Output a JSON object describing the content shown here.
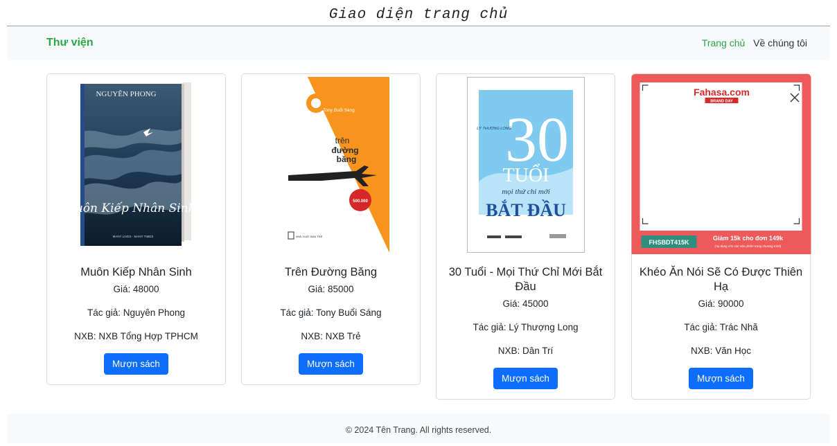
{
  "page_caption": "Giao diện trang chủ",
  "navbar": {
    "brand": "Thư viện",
    "links": [
      "Trang chủ",
      "Về chúng tôi"
    ]
  },
  "books": [
    {
      "title": "Muôn Kiếp Nhân Sinh",
      "price": "Giá: 48000",
      "author": "Tác giả: Nguyên Phong",
      "publisher": "NXB: NXB Tổng Hợp TPHCM",
      "button": "Mượn sách",
      "cover": {
        "author_text": "NGUYÊN PHONG",
        "title_text": "Muôn Kiếp Nhân Sinh",
        "sub": "MANY LIVES - MANY TIMES"
      }
    },
    {
      "title": "Trên Đường Băng",
      "price": "Giá: 85000",
      "author": "Tác giả: Tony Buổi Sáng",
      "publisher": "NXB: NXB Trẻ",
      "button": "Mượn sách",
      "cover": {
        "author_text": "Tony Buổi Sáng",
        "title_line1": "trên",
        "title_line2": "đường",
        "title_line3": "băng",
        "badge": "500.000",
        "publisher_text": "NHÀ XUẤT BẢN TRẺ"
      }
    },
    {
      "title": "30 Tuổi - Mọi Thứ Chỉ Mới Bắt Đầu",
      "price": "Giá: 45000",
      "author": "Tác giả: Lý Thượng Long",
      "publisher": "NXB: Dân Trí",
      "button": "Mượn sách",
      "cover": {
        "author_text": "LÝ THƯỢNG LONG",
        "big_number": "30",
        "big_word": "TUỔI",
        "sub_line": "mọi thứ chỉ mới",
        "bottom_line": "BẮT ĐẦU"
      }
    },
    {
      "title": "Khéo Ăn Nói Sẽ Có Được Thiên Hạ",
      "price": "Giá: 90000",
      "author": "Tác giả: Trác Nhã",
      "publisher": "NXB: Văn Học",
      "button": "Mượn sách",
      "cover": {
        "brand_text": "Fahasa.com",
        "brand_sub": "BRAND DAY",
        "code": "FHSBDT415K",
        "promo": "Giảm 15k cho đơn 149k",
        "promo_note": "(Áp dụng cho các sản phẩm trong chương trình)"
      }
    }
  ],
  "footer": {
    "text": "© 2024 Tên Trang. All rights reserved."
  },
  "colors": {
    "brand": "#28a745",
    "primary_button": "#0d6efd",
    "navbar_bg": "#f8f9fa"
  }
}
